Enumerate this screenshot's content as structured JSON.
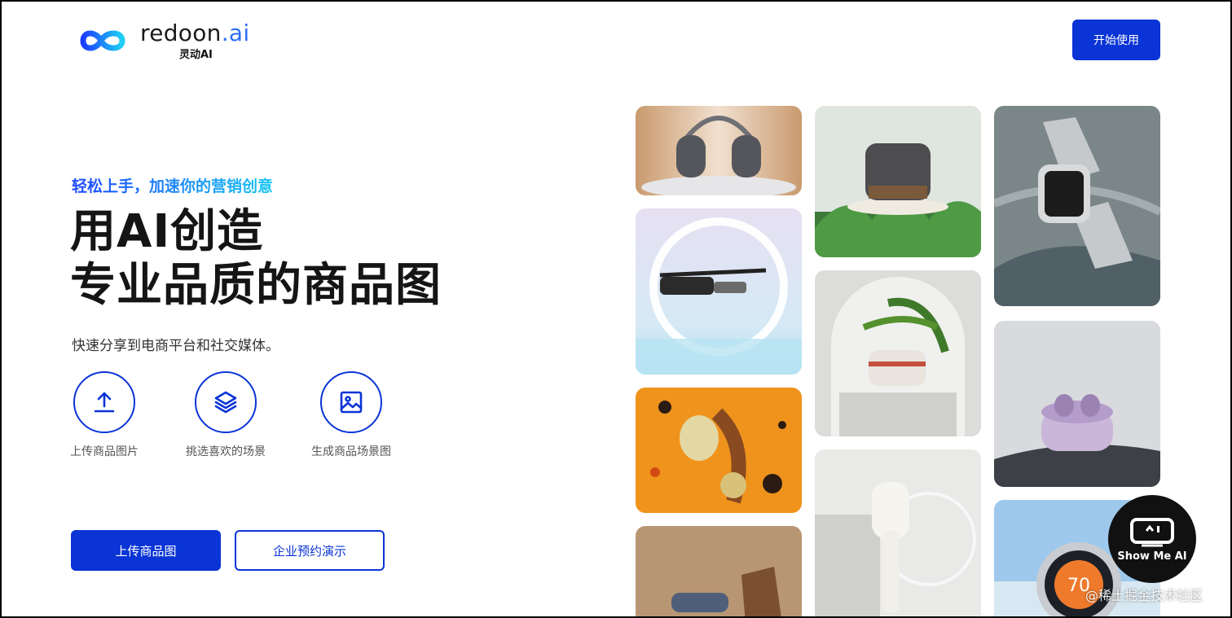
{
  "header": {
    "logo_word": "redoon",
    "logo_ai": ".ai",
    "logo_sub": "灵动AI",
    "start_button": "开始使用"
  },
  "hero": {
    "tagline": "轻松上手，加速你的营销创意",
    "title_line1": "用AI创造",
    "title_line2": "专业品质的商品图",
    "subtitle": "快速分享到电商平台和社交媒体。"
  },
  "steps": [
    {
      "label": "上传商品图片",
      "icon": "upload-icon"
    },
    {
      "label": "挑选喜欢的场景",
      "icon": "layers-icon"
    },
    {
      "label": "生成商品场景图",
      "icon": "image-icon"
    }
  ],
  "actions": {
    "primary": "上传商品图",
    "secondary": "企业预约演示"
  },
  "gallery": [
    {
      "subject": "headphones"
    },
    {
      "subject": "rice-cooker"
    },
    {
      "subject": "smartwatch"
    },
    {
      "subject": "smart-glasses"
    },
    {
      "subject": "steamer-pot"
    },
    {
      "subject": "wearable-clip"
    },
    {
      "subject": "earbuds"
    },
    {
      "subject": "garment-steamer"
    },
    {
      "subject": "hair-dryer"
    },
    {
      "subject": "thermostat",
      "reading": "70"
    }
  ],
  "badge": {
    "icon": "robot-face-icon",
    "text": "Show Me AI"
  },
  "watermark": "@稀土掘金技术社区",
  "colors": {
    "accent": "#0a34d6",
    "tagline_start": "#1d48ff",
    "tagline_end": "#19c6f2"
  }
}
